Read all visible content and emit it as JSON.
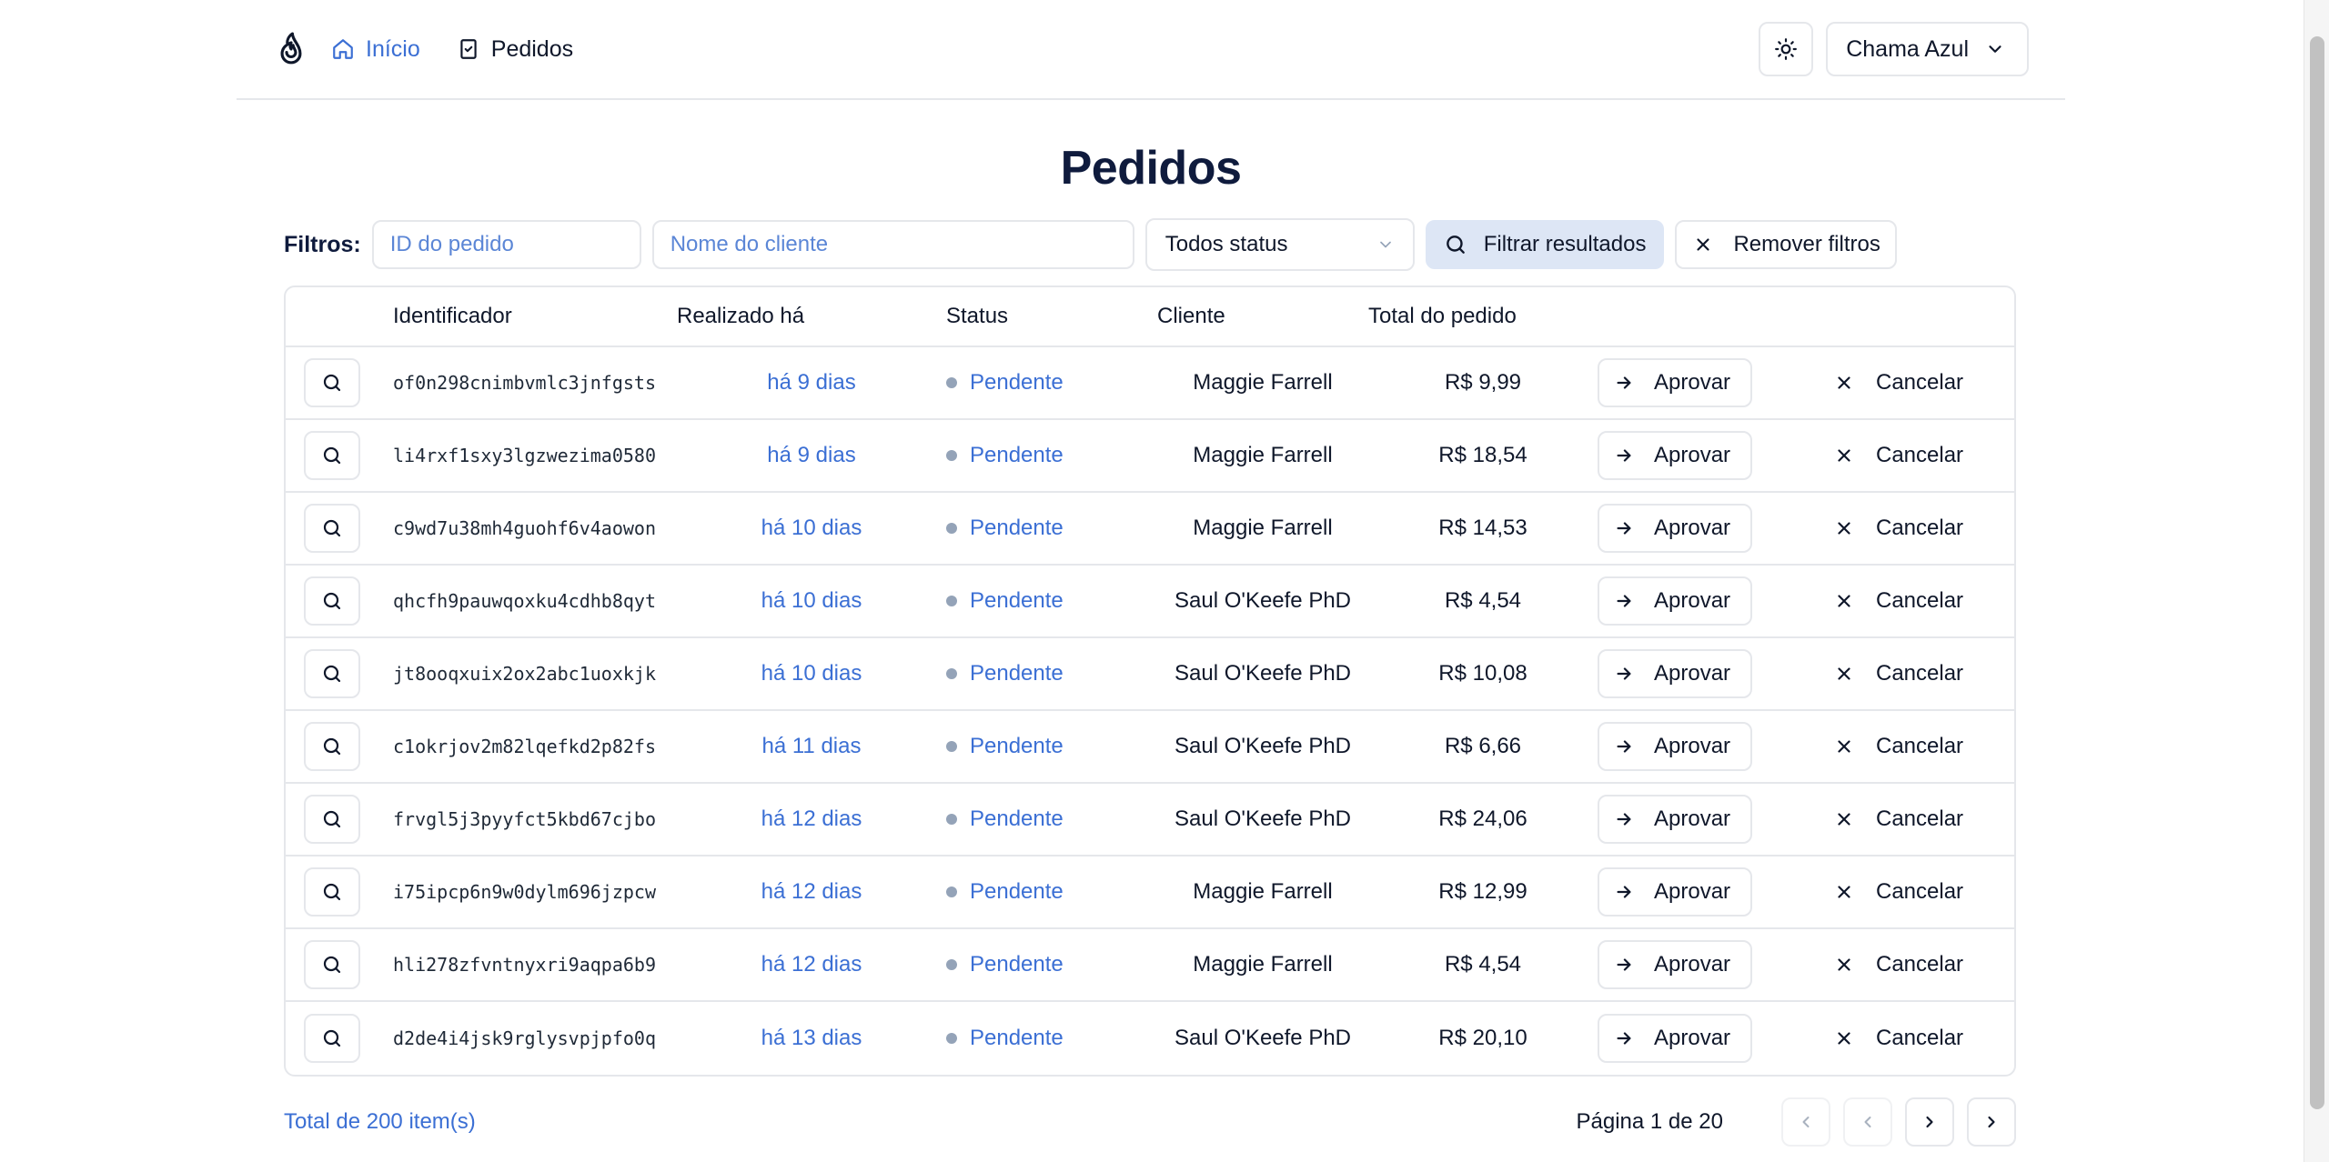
{
  "nav": {
    "home_label": "Início",
    "orders_label": "Pedidos",
    "account_label": "Chama Azul"
  },
  "page": {
    "title": "Pedidos"
  },
  "filters": {
    "label": "Filtros:",
    "order_id_placeholder": "ID do pedido",
    "customer_placeholder": "Nome do cliente",
    "status_selected": "Todos status",
    "apply_label": "Filtrar resultados",
    "clear_label": "Remover filtros"
  },
  "table": {
    "headers": {
      "id": "Identificador",
      "date": "Realizado há",
      "status": "Status",
      "client": "Cliente",
      "total": "Total do pedido"
    },
    "approve_label": "Aprovar",
    "cancel_label": "Cancelar",
    "rows": [
      {
        "id": "of0n298cnimbvmlc3jnfgsts",
        "date": "há 9 dias",
        "status": "Pendente",
        "client": "Maggie Farrell",
        "total": "R$ 9,99"
      },
      {
        "id": "li4rxf1sxy3lgzwezima0580",
        "date": "há 9 dias",
        "status": "Pendente",
        "client": "Maggie Farrell",
        "total": "R$ 18,54"
      },
      {
        "id": "c9wd7u38mh4guohf6v4aowon",
        "date": "há 10 dias",
        "status": "Pendente",
        "client": "Maggie Farrell",
        "total": "R$ 14,53"
      },
      {
        "id": "qhcfh9pauwqoxku4cdhb8qyt",
        "date": "há 10 dias",
        "status": "Pendente",
        "client": "Saul O'Keefe PhD",
        "total": "R$ 4,54"
      },
      {
        "id": "jt8ooqxuix2ox2abc1uoxkjk",
        "date": "há 10 dias",
        "status": "Pendente",
        "client": "Saul O'Keefe PhD",
        "total": "R$ 10,08"
      },
      {
        "id": "c1okrjov2m82lqefkd2p82fs",
        "date": "há 11 dias",
        "status": "Pendente",
        "client": "Saul O'Keefe PhD",
        "total": "R$ 6,66"
      },
      {
        "id": "frvgl5j3pyyfct5kbd67cjbo",
        "date": "há 12 dias",
        "status": "Pendente",
        "client": "Saul O'Keefe PhD",
        "total": "R$ 24,06"
      },
      {
        "id": "i75ipcp6n9w0dylm696jzpcw",
        "date": "há 12 dias",
        "status": "Pendente",
        "client": "Maggie Farrell",
        "total": "R$ 12,99"
      },
      {
        "id": "hli278zfvntnyxri9aqpa6b9",
        "date": "há 12 dias",
        "status": "Pendente",
        "client": "Maggie Farrell",
        "total": "R$ 4,54"
      },
      {
        "id": "d2de4i4jsk9rglysvpjpfo0q",
        "date": "há 13 dias",
        "status": "Pendente",
        "client": "Saul O'Keefe PhD",
        "total": "R$ 20,10"
      }
    ]
  },
  "footer": {
    "total_items": "Total de 200 item(s)",
    "page_label": "Página 1 de 20"
  },
  "colors": {
    "accent": "#3b6fd4",
    "title": "#0f1b3d",
    "filter_button_bg": "#dde6f5",
    "border": "#e5e7eb"
  }
}
